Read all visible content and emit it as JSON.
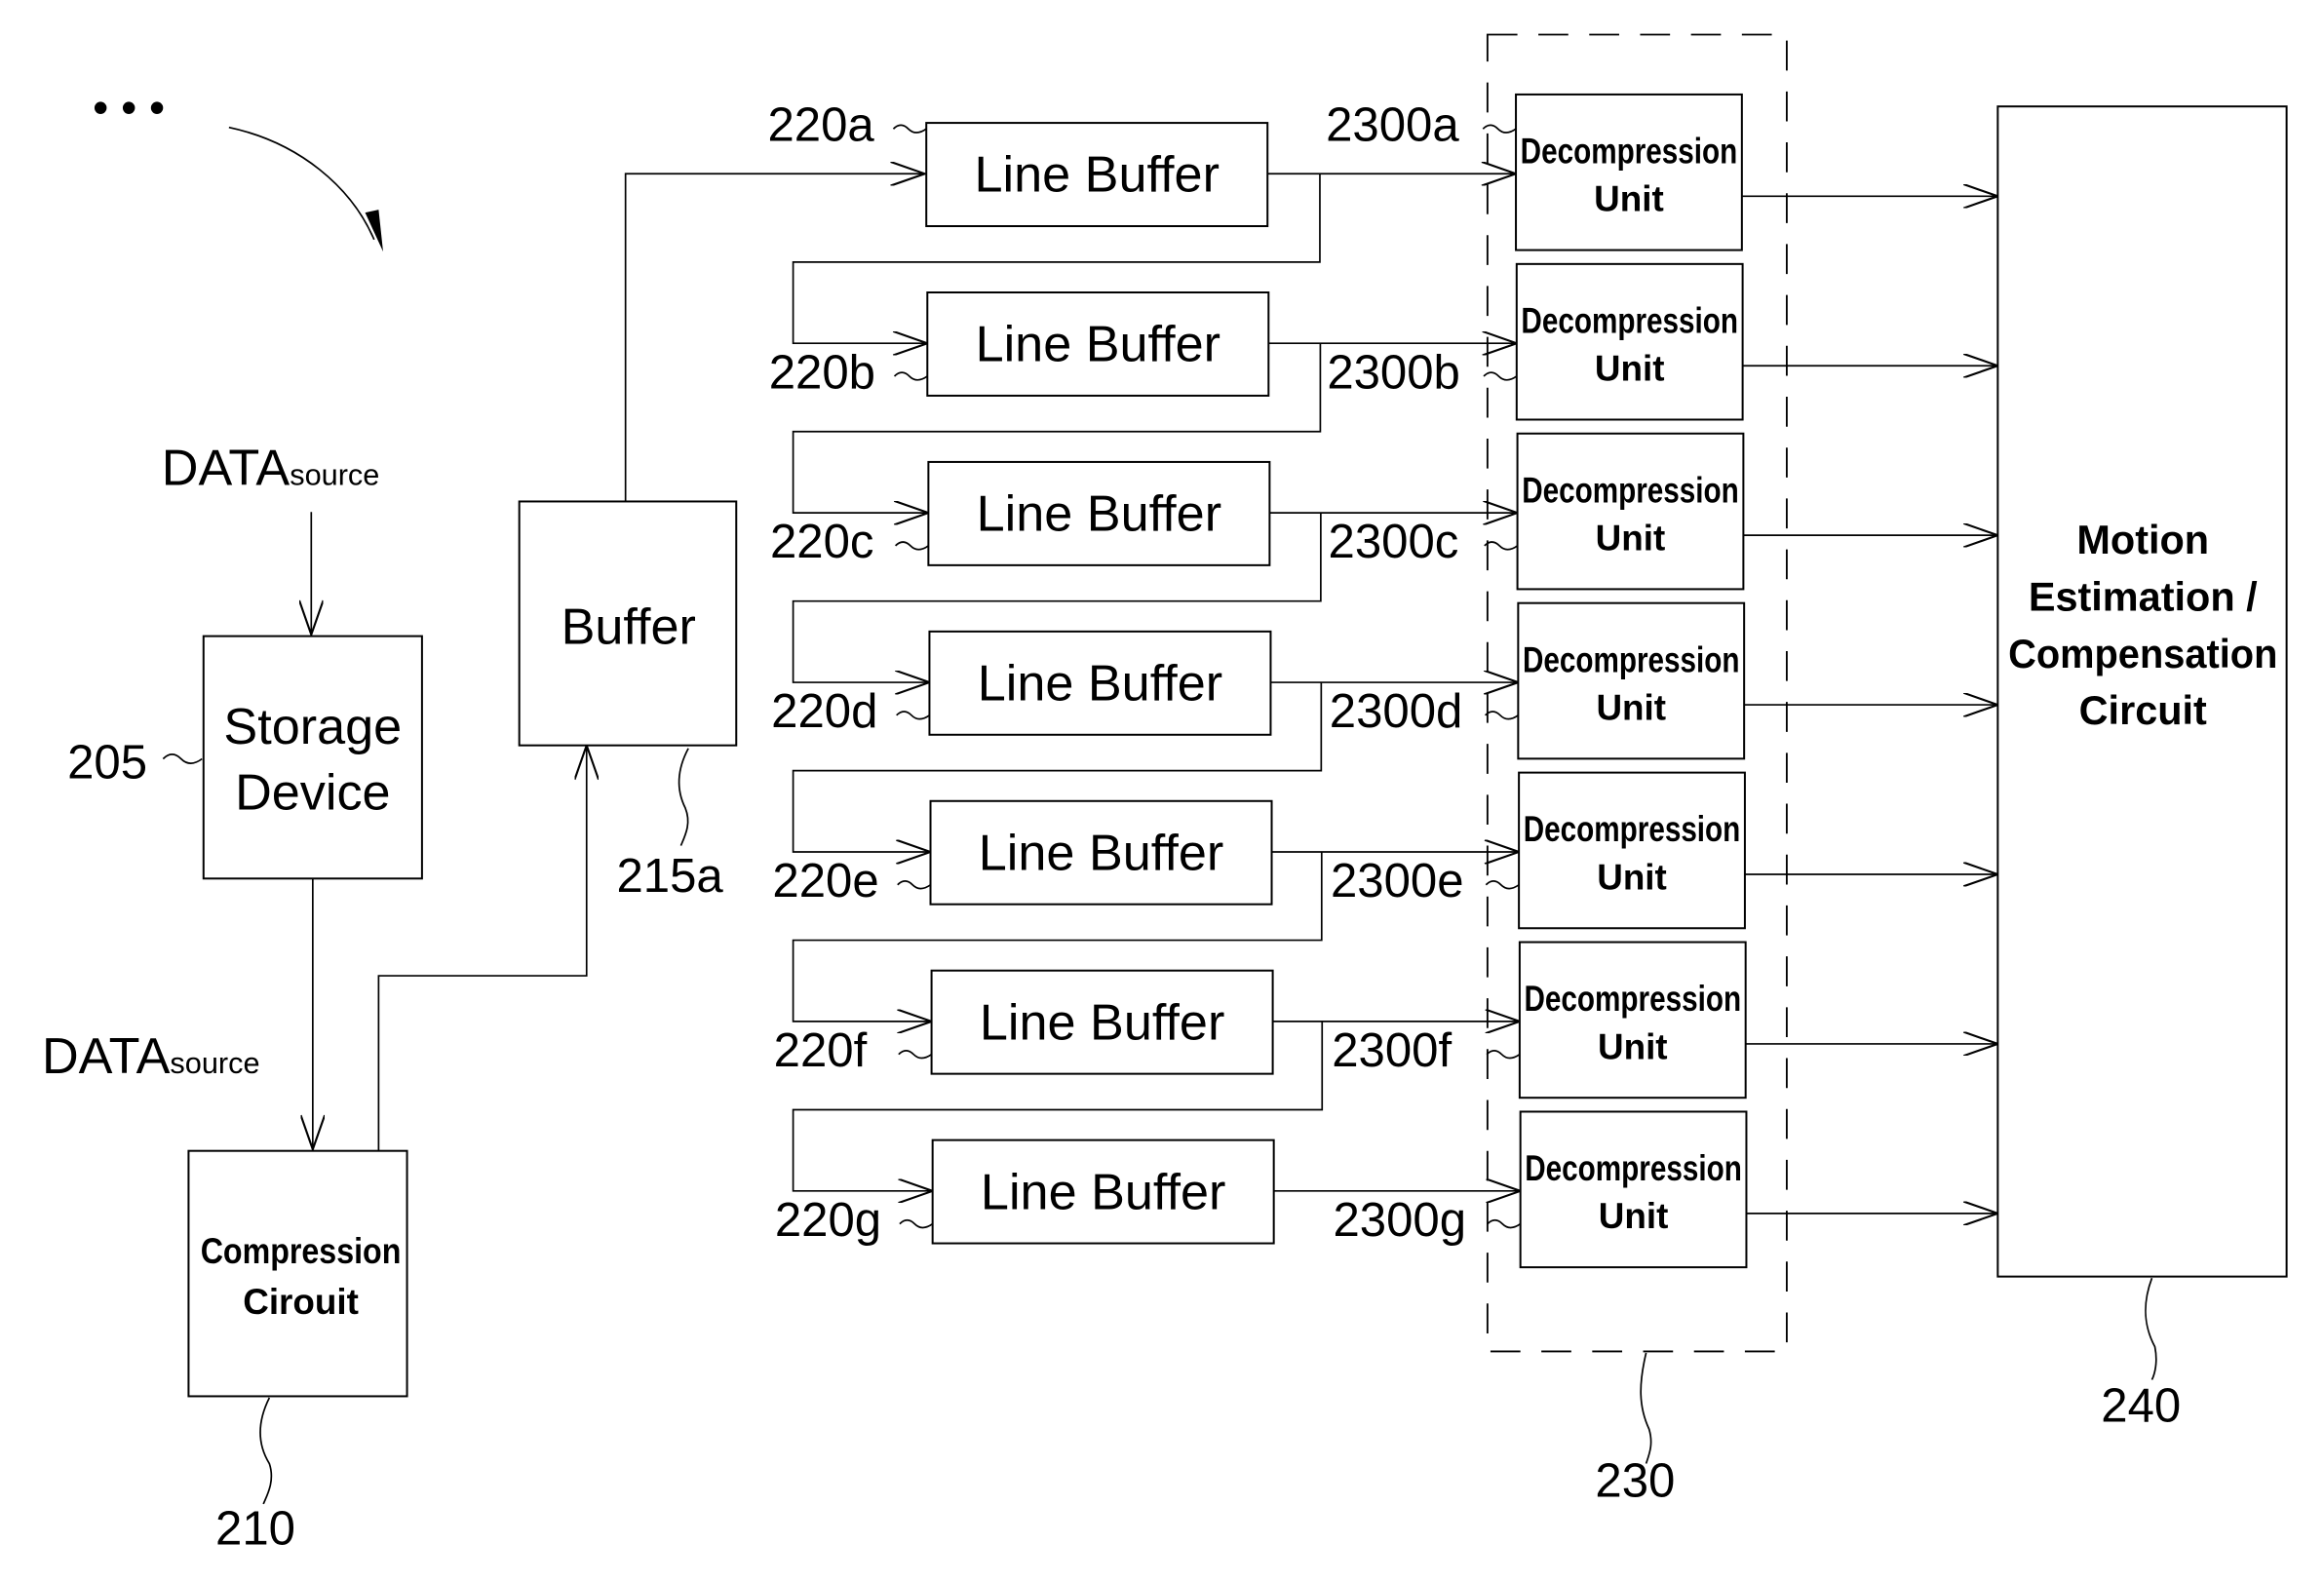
{
  "figure": {
    "continuation_marker": "• • •",
    "data_source_label": {
      "main": "DATA",
      "sub": "source"
    },
    "storage_device": {
      "ref": "205",
      "lines": [
        "Storage",
        "Device"
      ]
    },
    "compression_circuit": {
      "ref": "210",
      "lines": [
        "Compression",
        "Cirouit"
      ]
    },
    "buffer": {
      "ref": "215a",
      "label": "Buffer"
    },
    "line_buffers": [
      {
        "ref": "220a",
        "label": "Line Buffer"
      },
      {
        "ref": "220b",
        "label": "Line Buffer"
      },
      {
        "ref": "220c",
        "label": "Line Buffer"
      },
      {
        "ref": "220d",
        "label": "Line Buffer"
      },
      {
        "ref": "220e",
        "label": "Line Buffer"
      },
      {
        "ref": "220f",
        "label": "Line Buffer"
      },
      {
        "ref": "220g",
        "label": "Line Buffer"
      }
    ],
    "decompression_units": [
      {
        "ref": "2300a",
        "lines": [
          "Decompression",
          "Unit"
        ]
      },
      {
        "ref": "2300b",
        "lines": [
          "Decompression",
          "Unit"
        ]
      },
      {
        "ref": "2300c",
        "lines": [
          "Decompression",
          "Unit"
        ]
      },
      {
        "ref": "2300d",
        "lines": [
          "Decompression",
          "Unit"
        ]
      },
      {
        "ref": "2300e",
        "lines": [
          "Decompression",
          "Unit"
        ]
      },
      {
        "ref": "2300f",
        "lines": [
          "Decompression",
          "Unit"
        ]
      },
      {
        "ref": "2300g",
        "lines": [
          "Decompression",
          "Unit"
        ]
      }
    ],
    "decompression_group": {
      "ref": "230"
    },
    "motion_circuit": {
      "ref": "240",
      "lines": [
        "Motion",
        "Estimation /",
        "Compensation",
        "Circuit"
      ]
    }
  }
}
